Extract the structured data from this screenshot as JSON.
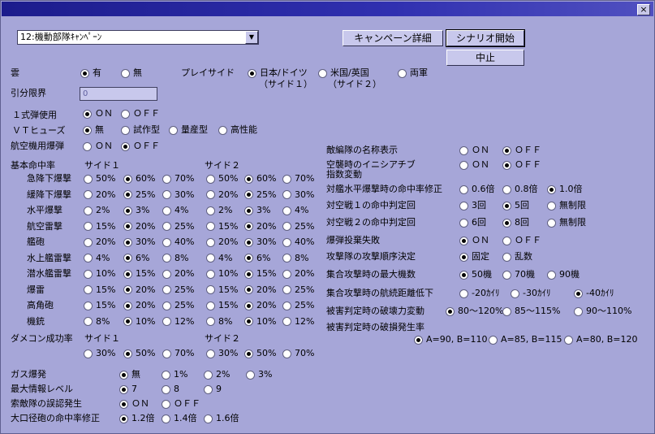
{
  "window": {
    "close_label": "×"
  },
  "scenario": {
    "selected": "12:機動部隊ｷｬﾝﾍﾟｰﾝ",
    "arrow": "▼"
  },
  "buttons": {
    "detail": "キャンペーン詳細",
    "start": "シナリオ開始",
    "stop": "中止"
  },
  "left": {
    "cloud": {
      "label": "雲",
      "opts": [
        "有",
        "無"
      ],
      "sel": 0
    },
    "play_side": {
      "label": "プレイサイド",
      "opts": [
        "日本/ドイツ",
        "米国/英国",
        "両軍"
      ],
      "subs": [
        "（サイド１）",
        "（サイド２）"
      ],
      "sel": 0
    },
    "inbun": {
      "label": "引分限界",
      "value": "0"
    },
    "type1": {
      "label": "１式弾使用",
      "opts": [
        "ＯＮ",
        "ＯＦＦ"
      ],
      "sel": 0
    },
    "vt": {
      "label": "ＶＴヒューズ",
      "opts": [
        "無",
        "試作型",
        "量産型",
        "高性能"
      ],
      "sel": 0
    },
    "aircraft_bomb": {
      "label": "航空機用爆弾",
      "opts": [
        "ＯＮ",
        "ＯＦＦ"
      ],
      "sel": 1
    },
    "hit": {
      "label": "基本命中率",
      "side1": "サイド１",
      "side2": "サイド２",
      "rows": [
        {
          "label": "急降下爆撃",
          "opts": [
            "50%",
            "60%",
            "70%"
          ],
          "s1": 1,
          "s2": 1
        },
        {
          "label": "緩降下爆撃",
          "opts": [
            "20%",
            "25%",
            "30%"
          ],
          "s1": 1,
          "s2": 1
        },
        {
          "label": "水平爆撃",
          "opts": [
            "2%",
            "3%",
            "4%"
          ],
          "s1": 1,
          "s2": 1
        },
        {
          "label": "航空雷撃",
          "opts": [
            "15%",
            "20%",
            "25%"
          ],
          "s1": 1,
          "s2": 1
        },
        {
          "label": "艦砲",
          "opts": [
            "20%",
            "30%",
            "40%"
          ],
          "s1": 1,
          "s2": 1
        },
        {
          "label": "水上艦雷撃",
          "opts": [
            "4%",
            "6%",
            "8%"
          ],
          "s1": 1,
          "s2": 1
        },
        {
          "label": "潜水艦雷撃",
          "opts": [
            "10%",
            "15%",
            "20%"
          ],
          "s1": 1,
          "s2": 1
        },
        {
          "label": "爆雷",
          "opts": [
            "15%",
            "20%",
            "25%"
          ],
          "s1": 1,
          "s2": 1
        },
        {
          "label": "高角砲",
          "opts": [
            "15%",
            "20%",
            "25%"
          ],
          "s1": 1,
          "s2": 1
        },
        {
          "label": "機銃",
          "opts": [
            "8%",
            "10%",
            "12%"
          ],
          "s1": 1,
          "s2": 1
        }
      ]
    },
    "damecon": {
      "label": "ダメコン成功率",
      "side1": "サイド１",
      "side2": "サイド２",
      "opts": [
        "30%",
        "50%",
        "70%"
      ],
      "s1": 1,
      "s2": 1
    },
    "gas": {
      "label": "ガス爆発",
      "opts": [
        "無",
        "1%",
        "2%",
        "3%"
      ],
      "sel": 0
    },
    "maxinfo": {
      "label": "最大情報レベル",
      "opts": [
        "7",
        "8",
        "9"
      ],
      "sel": 0
    },
    "search": {
      "label": "索敵隊の誤認発生",
      "opts": [
        "ＯＮ",
        "ＯＦＦ"
      ],
      "sel": 0
    },
    "bigcal": {
      "label": "大口径砲の命中率修正",
      "opts": [
        "1.2倍",
        "1.4倍",
        "1.6倍"
      ],
      "sel": 0
    }
  },
  "right": [
    {
      "label": "敵編隊の名称表示",
      "opts": [
        "ＯＮ",
        "ＯＦＦ"
      ],
      "sel": 1
    },
    {
      "label": "空襲時のイニシアチブ",
      "label2": "指数変動",
      "opts": [
        "ＯＮ",
        "ＯＦＦ"
      ],
      "sel": 1
    },
    {
      "label": "対艦水平爆撃時の命中率修正",
      "opts": [
        "0.6倍",
        "0.8倍",
        "1.0倍"
      ],
      "sel": 2
    },
    {
      "label": "対空戦１の命中判定回",
      "opts": [
        "3回",
        "5回",
        "無制限"
      ],
      "sel": 1
    },
    {
      "label": "対空戦２の命中判定回",
      "opts": [
        "6回",
        "8回",
        "無制限"
      ],
      "sel": 1
    },
    {
      "label": "爆弾投棄失敗",
      "opts": [
        "ＯＮ",
        "ＯＦＦ"
      ],
      "sel": 0
    },
    {
      "label": "攻撃隊の攻撃順序決定",
      "opts": [
        "固定",
        "乱数"
      ],
      "sel": 0
    },
    {
      "label": "集合攻撃時の最大機数",
      "opts": [
        "50機",
        "70機",
        "90機"
      ],
      "sel": 0
    },
    {
      "label": "集合攻撃時の航続距離低下",
      "opts": [
        "-20ｶｲﾘ",
        "-30ｶｲﾘ",
        "-40ｶｲﾘ"
      ],
      "sel": 2
    },
    {
      "label": "被害判定時の破壊力変動",
      "opts": [
        "80～120%",
        "85～115%",
        "90～110%"
      ],
      "sel": 0
    },
    {
      "label": "被害判定時の破損発生率",
      "opts": [
        "A=90, B=110",
        "A=85, B=115",
        "A=80, B=120"
      ],
      "sel": 0
    }
  ],
  "colors": {
    "background": "#a6a6d8",
    "titlebar": "#1c1c8c"
  }
}
